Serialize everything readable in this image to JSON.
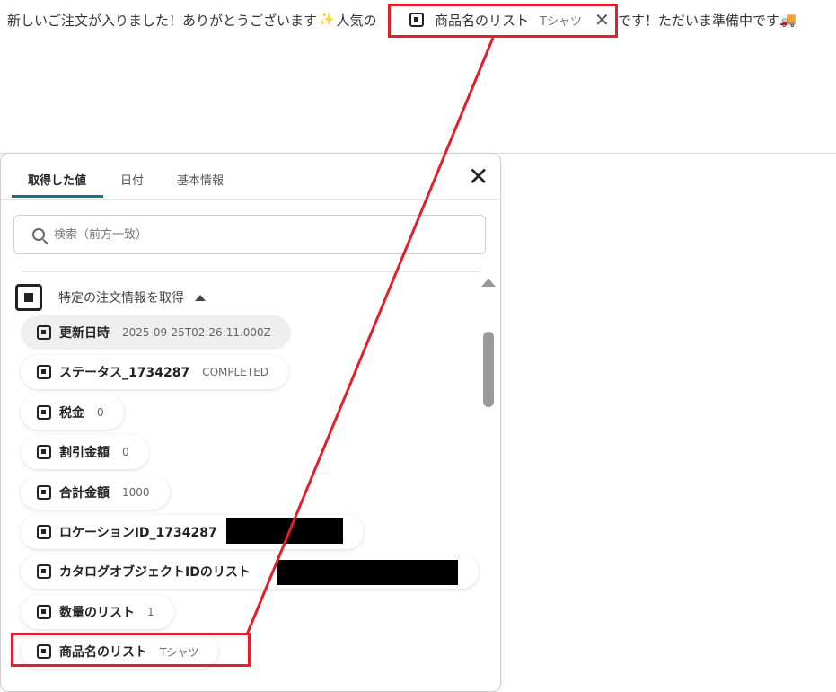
{
  "message": {
    "prefix": "新しいご注文が入りました！ありがとうございます",
    "sparkle_emoji": "✨",
    "middle": " 人気の",
    "suffix": "です！ただいま準備中です",
    "truck_emoji": "🚚",
    "inline_chip": {
      "name": "商品名のリスト",
      "value": "Tシャツ",
      "close": "✕"
    }
  },
  "panel": {
    "tabs": [
      {
        "label": "取得した値"
      },
      {
        "label": "日付"
      },
      {
        "label": "基本情報"
      }
    ],
    "close": "✕",
    "search": {
      "placeholder": "検索（前方一致）"
    },
    "section": {
      "title": "特定の注文情報を取得"
    },
    "items": [
      {
        "label": "更新日時",
        "value": "2025-09-25T02:26:11.000Z"
      },
      {
        "label": "ステータス_1734287",
        "value": "COMPLETED"
      },
      {
        "label": "税金",
        "value": "0"
      },
      {
        "label": "割引金額",
        "value": "0"
      },
      {
        "label": "合計金額",
        "value": "1000"
      },
      {
        "label": "ロケーションID_1734287",
        "value": ""
      },
      {
        "label": "カタログオブジェクトIDのリスト",
        "value": ""
      },
      {
        "label": "数量のリスト",
        "value": "1"
      },
      {
        "label": "商品名のリスト",
        "value": "Tシャツ"
      }
    ]
  },
  "colors": {
    "highlight": "#e0202c",
    "tab_accent": "#1d6f8a"
  }
}
